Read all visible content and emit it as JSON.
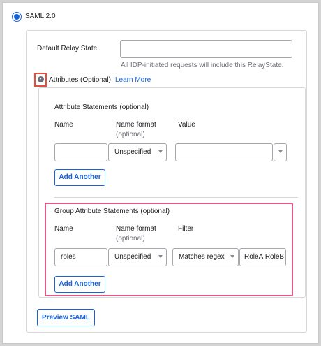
{
  "saml": {
    "label": "SAML 2.0"
  },
  "relay_state": {
    "label": "Default Relay State",
    "value": "",
    "help": "All IDP-initiated requests will include this RelayState."
  },
  "attributes": {
    "toggle_label": "Attributes (Optional)",
    "learn_more": "Learn More"
  },
  "attribute_statements": {
    "title": "Attribute Statements (optional)",
    "col_name": "Name",
    "col_format": "Name format",
    "col_format_sub": "(optional)",
    "col_value": "Value",
    "name_value": "",
    "format_value": "Unspecified",
    "value_value": "",
    "add_label": "Add Another"
  },
  "group_statements": {
    "title": "Group Attribute Statements (optional)",
    "col_name": "Name",
    "col_format": "Name format",
    "col_format_sub": "(optional)",
    "col_filter": "Filter",
    "name_value": "roles",
    "format_value": "Unspecified",
    "filter_type": "Matches regex",
    "filter_value": "RoleA|RoleB",
    "add_label": "Add Another"
  },
  "preview": {
    "label": "Preview SAML"
  },
  "colors": {
    "accent": "#1662dd",
    "highlight_pink": "#e15a86",
    "highlight_red": "#e74c3c"
  }
}
